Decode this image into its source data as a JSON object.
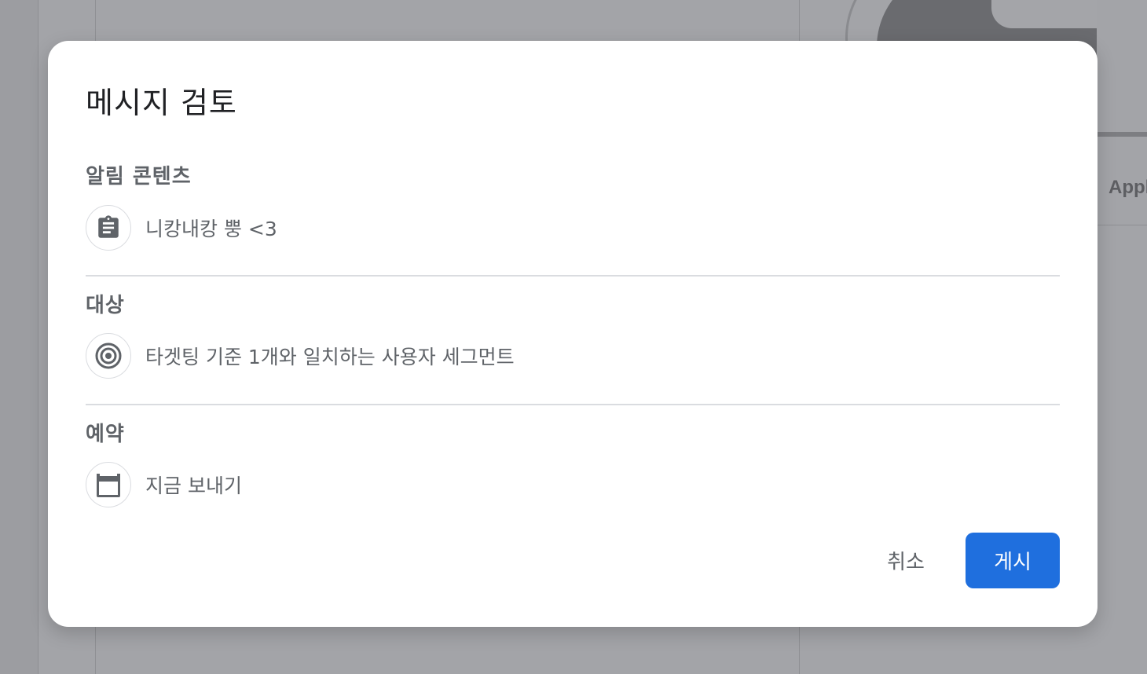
{
  "background": {
    "partial_label": "Appl"
  },
  "dialog": {
    "title": "메시지 검토",
    "sections": [
      {
        "label": "알림 콘텐츠",
        "icon": "clipboard-icon",
        "value": "니캉내캉 뿡 <3"
      },
      {
        "label": "대상",
        "icon": "target-icon",
        "value": "타겟팅 기준 1개와 일치하는 사용자 세그먼트"
      },
      {
        "label": "예약",
        "icon": "calendar-icon",
        "value": "지금 보내기"
      }
    ],
    "actions": {
      "cancel_label": "취소",
      "publish_label": "게시"
    }
  },
  "colors": {
    "primary": "#1f6fde",
    "scrim": "#a3a4a8",
    "text_secondary": "#5f6368",
    "text_primary": "#202124",
    "divider": "#dadce0"
  }
}
